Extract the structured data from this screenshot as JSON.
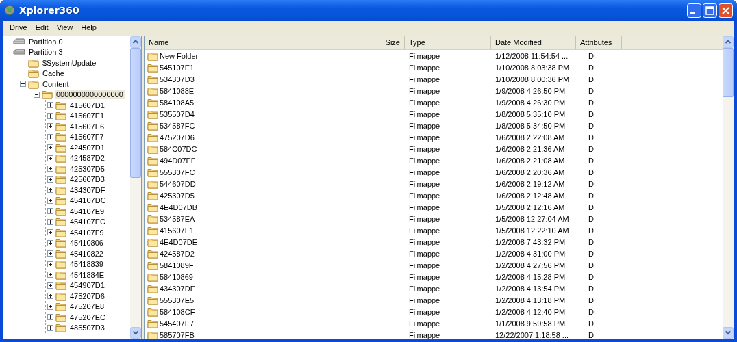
{
  "window": {
    "title": "Xplorer360"
  },
  "menu": [
    "Drive",
    "Edit",
    "View",
    "Help"
  ],
  "tree": [
    {
      "label": "Partition 0",
      "kind": "drive",
      "expandable": false,
      "selected": false
    },
    {
      "label": "Partition 3",
      "kind": "drive",
      "expandable": false,
      "selected": false,
      "children": [
        {
          "label": "$SystemUpdate",
          "kind": "folder",
          "expandable": false,
          "selected": false
        },
        {
          "label": "Cache",
          "kind": "folder",
          "expandable": false,
          "selected": false
        },
        {
          "label": "Content",
          "kind": "folder",
          "expandable": true,
          "expanded": true,
          "selected": false,
          "children": [
            {
              "label": "0000000000000000",
              "kind": "folder",
              "expandable": true,
              "expanded": true,
              "selected": true,
              "children": [
                {
                  "label": "415607D1",
                  "kind": "folder",
                  "expandable": true,
                  "expanded": false,
                  "selected": false
                },
                {
                  "label": "415607E1",
                  "kind": "folder",
                  "expandable": true,
                  "expanded": false,
                  "selected": false
                },
                {
                  "label": "415607E6",
                  "kind": "folder",
                  "expandable": true,
                  "expanded": false,
                  "selected": false
                },
                {
                  "label": "415607F7",
                  "kind": "folder",
                  "expandable": true,
                  "expanded": false,
                  "selected": false
                },
                {
                  "label": "424507D1",
                  "kind": "folder",
                  "expandable": true,
                  "expanded": false,
                  "selected": false
                },
                {
                  "label": "424587D2",
                  "kind": "folder",
                  "expandable": true,
                  "expanded": false,
                  "selected": false
                },
                {
                  "label": "425307D5",
                  "kind": "folder",
                  "expandable": true,
                  "expanded": false,
                  "selected": false
                },
                {
                  "label": "425607D3",
                  "kind": "folder",
                  "expandable": true,
                  "expanded": false,
                  "selected": false
                },
                {
                  "label": "434307DF",
                  "kind": "folder",
                  "expandable": true,
                  "expanded": false,
                  "selected": false
                },
                {
                  "label": "454107DC",
                  "kind": "folder",
                  "expandable": true,
                  "expanded": false,
                  "selected": false
                },
                {
                  "label": "454107E9",
                  "kind": "folder",
                  "expandable": true,
                  "expanded": false,
                  "selected": false
                },
                {
                  "label": "454107EC",
                  "kind": "folder",
                  "expandable": true,
                  "expanded": false,
                  "selected": false
                },
                {
                  "label": "454107F9",
                  "kind": "folder",
                  "expandable": true,
                  "expanded": false,
                  "selected": false
                },
                {
                  "label": "45410806",
                  "kind": "folder",
                  "expandable": true,
                  "expanded": false,
                  "selected": false
                },
                {
                  "label": "45410822",
                  "kind": "folder",
                  "expandable": true,
                  "expanded": false,
                  "selected": false
                },
                {
                  "label": "45418839",
                  "kind": "folder",
                  "expandable": true,
                  "expanded": false,
                  "selected": false
                },
                {
                  "label": "4541884E",
                  "kind": "folder",
                  "expandable": true,
                  "expanded": false,
                  "selected": false
                },
                {
                  "label": "454907D1",
                  "kind": "folder",
                  "expandable": true,
                  "expanded": false,
                  "selected": false
                },
                {
                  "label": "475207D6",
                  "kind": "folder",
                  "expandable": true,
                  "expanded": false,
                  "selected": false
                },
                {
                  "label": "475207E8",
                  "kind": "folder",
                  "expandable": true,
                  "expanded": false,
                  "selected": false
                },
                {
                  "label": "475207EC",
                  "kind": "folder",
                  "expandable": true,
                  "expanded": false,
                  "selected": false
                },
                {
                  "label": "485507D3",
                  "kind": "folder",
                  "expandable": true,
                  "expanded": false,
                  "selected": false
                }
              ]
            }
          ]
        }
      ]
    }
  ],
  "table": {
    "columns": [
      {
        "label": "Name"
      },
      {
        "label": "Size"
      },
      {
        "label": "Type"
      },
      {
        "label": "Date Modified"
      },
      {
        "label": "Attributes"
      }
    ],
    "rows": [
      {
        "name": "New Folder",
        "type": "Filmappe",
        "date": "1/12/2008 11:54:54 ...",
        "attributes": "D"
      },
      {
        "name": "545107E1",
        "type": "Filmappe",
        "date": "1/10/2008 8:03:38 PM",
        "attributes": "D"
      },
      {
        "name": "534307D3",
        "type": "Filmappe",
        "date": "1/10/2008 8:00:36 PM",
        "attributes": "D"
      },
      {
        "name": "5841088E",
        "type": "Filmappe",
        "date": "1/9/2008 4:26:50 PM",
        "attributes": "D"
      },
      {
        "name": "584108A5",
        "type": "Filmappe",
        "date": "1/9/2008 4:26:30 PM",
        "attributes": "D"
      },
      {
        "name": "535507D4",
        "type": "Filmappe",
        "date": "1/8/2008 5:35:10 PM",
        "attributes": "D"
      },
      {
        "name": "534587FC",
        "type": "Filmappe",
        "date": "1/8/2008 5:34:50 PM",
        "attributes": "D"
      },
      {
        "name": "475207D6",
        "type": "Filmappe",
        "date": "1/6/2008 2:22:08 AM",
        "attributes": "D"
      },
      {
        "name": "584C07DC",
        "type": "Filmappe",
        "date": "1/6/2008 2:21:36 AM",
        "attributes": "D"
      },
      {
        "name": "494D07EF",
        "type": "Filmappe",
        "date": "1/6/2008 2:21:08 AM",
        "attributes": "D"
      },
      {
        "name": "555307FC",
        "type": "Filmappe",
        "date": "1/6/2008 2:20:36 AM",
        "attributes": "D"
      },
      {
        "name": "544607DD",
        "type": "Filmappe",
        "date": "1/6/2008 2:19:12 AM",
        "attributes": "D"
      },
      {
        "name": "425307D5",
        "type": "Filmappe",
        "date": "1/6/2008 2:12:48 AM",
        "attributes": "D"
      },
      {
        "name": "4E4D07DB",
        "type": "Filmappe",
        "date": "1/5/2008 2:12:16 AM",
        "attributes": "D"
      },
      {
        "name": "534587EA",
        "type": "Filmappe",
        "date": "1/5/2008 12:27:04 AM",
        "attributes": "D"
      },
      {
        "name": "415607E1",
        "type": "Filmappe",
        "date": "1/5/2008 12:22:10 AM",
        "attributes": "D"
      },
      {
        "name": "4E4D07DE",
        "type": "Filmappe",
        "date": "1/2/2008 7:43:32 PM",
        "attributes": "D"
      },
      {
        "name": "424587D2",
        "type": "Filmappe",
        "date": "1/2/2008 4:31:00 PM",
        "attributes": "D"
      },
      {
        "name": "5841089F",
        "type": "Filmappe",
        "date": "1/2/2008 4:27:56 PM",
        "attributes": "D"
      },
      {
        "name": "58410869",
        "type": "Filmappe",
        "date": "1/2/2008 4:15:28 PM",
        "attributes": "D"
      },
      {
        "name": "434307DF",
        "type": "Filmappe",
        "date": "1/2/2008 4:13:54 PM",
        "attributes": "D"
      },
      {
        "name": "555307E5",
        "type": "Filmappe",
        "date": "1/2/2008 4:13:18 PM",
        "attributes": "D"
      },
      {
        "name": "584108CF",
        "type": "Filmappe",
        "date": "1/2/2008 4:12:40 PM",
        "attributes": "D"
      },
      {
        "name": "545407E7",
        "type": "Filmappe",
        "date": "1/1/2008 9:59:58 PM",
        "attributes": "D"
      },
      {
        "name": "585707FB",
        "type": "Filmappe",
        "date": "12/22/2007 1:18:58 ...",
        "attributes": "D"
      }
    ]
  }
}
